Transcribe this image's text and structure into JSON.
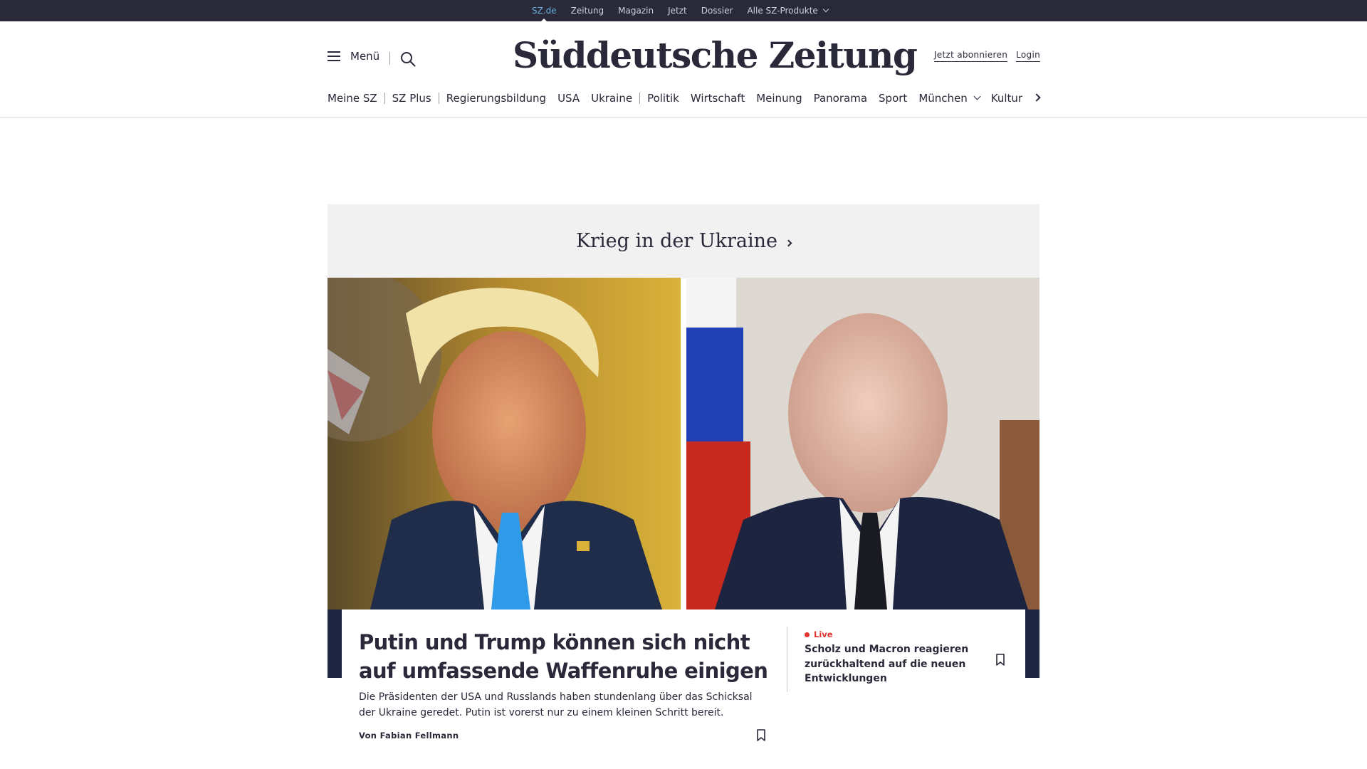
{
  "topbar": {
    "items": [
      {
        "label": "SZ.de",
        "active": true
      },
      {
        "label": "Zeitung"
      },
      {
        "label": "Magazin"
      },
      {
        "label": "Jetzt"
      },
      {
        "label": "Dossier"
      },
      {
        "label": "Alle SZ-Produkte",
        "dropdown": true
      }
    ]
  },
  "header": {
    "menu_label": "Menü",
    "logo_text": "Süddeutsche Zeitung",
    "subscribe_label": "Jetzt abonnieren",
    "login_label": "Login"
  },
  "nav": {
    "items": [
      {
        "label": "Meine SZ"
      },
      {
        "label": "SZ Plus"
      },
      {
        "label": "Regierungsbildung"
      },
      {
        "label": "USA"
      },
      {
        "label": "Ukraine"
      },
      {
        "label": "Politik"
      },
      {
        "label": "Wirtschaft"
      },
      {
        "label": "Meinung"
      },
      {
        "label": "Panorama"
      },
      {
        "label": "Sport"
      },
      {
        "label": "München",
        "dropdown": true
      },
      {
        "label": "Kultur"
      }
    ]
  },
  "section": {
    "title": "Krieg in der Ukraine"
  },
  "main_article": {
    "headline": "Putin und Trump können sich nicht auf umfassende Waffenruhe einigen",
    "teaser": "Die Präsidenten der USA und Russlands haben stundenlang über das Schicksal der Ukraine geredet. Putin ist vorerst nur zu einem kleinen Schritt bereit.",
    "author": "Von Fabian Fellmann"
  },
  "side_article": {
    "live_label": "Live",
    "headline": "Scholz und Macron reagieren zurückhaltend auf die neuen Entwicklungen"
  },
  "colors": {
    "topbar_bg": "#29293a",
    "active_link": "#6bb3e0",
    "text": "#29293a",
    "live": "#e3342f",
    "section_bg": "#f1f1f2"
  }
}
